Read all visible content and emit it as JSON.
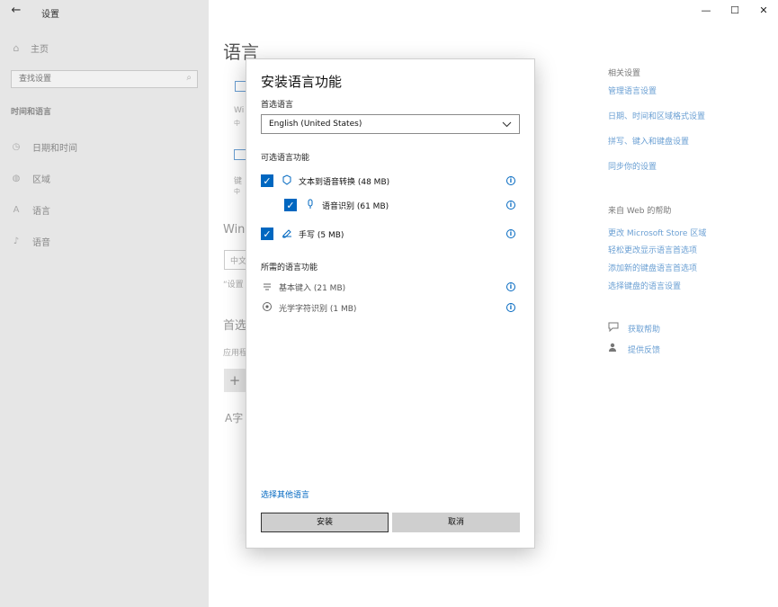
{
  "window": {
    "title": "设置",
    "back_icon": "←",
    "minimize_icon": "—",
    "maximize_icon": "☐",
    "close_icon": "✕"
  },
  "sidebar": {
    "home": "主页",
    "home_icon": "⌂",
    "search_placeholder": "查找设置",
    "search_icon": "⌕",
    "section": "时间和语言",
    "items": [
      {
        "label": "日期和时间",
        "icon": "◷"
      },
      {
        "label": "区域",
        "icon": "◍"
      },
      {
        "label": "语言",
        "icon": "A"
      },
      {
        "label": "语音",
        "icon": "♪"
      }
    ]
  },
  "main": {
    "page_title": "语言",
    "fragments": {
      "wi": "Wi",
      "zh1": "中",
      "jian": "键",
      "zh2": "中",
      "win": "Win",
      "zhong": "中文",
      "she": "“设置",
      "shou": "首选",
      "ying": "应用程",
      "plus": "+",
      "a_zi": "A字"
    }
  },
  "right_panel": {
    "related_heading": "相关设置",
    "related_links": [
      "管理语言设置",
      "日期、时间和区域格式设置",
      "拼写、键入和键盘设置",
      "同步你的设置"
    ],
    "web_heading": "来自 Web 的帮助",
    "web_links": [
      "更改 Microsoft Store 区域",
      "轻松更改显示语言首选项",
      "添加新的键盘语言首选项",
      "选择键盘的语言设置"
    ],
    "help": [
      {
        "label": "获取帮助",
        "icon": "help-chat-icon"
      },
      {
        "label": "提供反馈",
        "icon": "feedback-icon"
      }
    ]
  },
  "dialog": {
    "title": "安装语言功能",
    "preferred_label": "首选语言",
    "selected_language": "English (United States)",
    "optional_heading": "可选语言功能",
    "optional_features": [
      {
        "label": "文本到语音转换 (48 MB)",
        "checked": true
      },
      {
        "label": "语音识别 (61 MB)",
        "checked": true
      },
      {
        "label": "手写 (5 MB)",
        "checked": true
      }
    ],
    "required_heading": "所需的语言功能",
    "required_features": [
      {
        "label": "基本键入 (21 MB)"
      },
      {
        "label": "光学字符识别 (1 MB)"
      }
    ],
    "other_link": "选择其他语言",
    "install_label": "安装",
    "cancel_label": "取消",
    "check_mark": "✓",
    "info_mark": "i",
    "accent_color": "#0067c0"
  }
}
